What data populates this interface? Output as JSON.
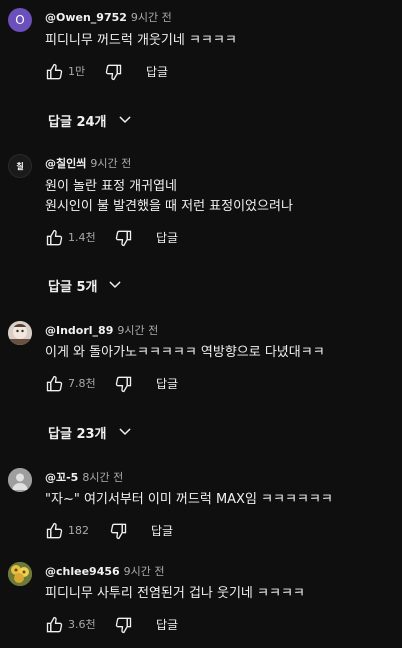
{
  "comments": [
    {
      "author": "@Owen_9752",
      "time": "9시간 전",
      "avatar_letter": "O",
      "avatar_color": "#6b4fbb",
      "lines": [
        "피디니무 꺼드럭 개웃기네 ㅋㅋㅋㅋ"
      ],
      "likes": "1만",
      "reply_label": "답글",
      "replies_label": "답글 24개"
    },
    {
      "author": "@칠인씌",
      "time": "9시간 전",
      "avatar_letter": "칠",
      "avatar_color": "#1a1a1a",
      "lines": [
        "원이 놀란 표정 개귀엽네",
        "원시인이 불 발견했을 때 저런 표정이었으려나"
      ],
      "likes": "1.4천",
      "reply_label": "답글",
      "replies_label": "답글 5개"
    },
    {
      "author": "@Indorl_89",
      "time": "9시간 전",
      "avatar_color": "#8a7565",
      "lines": [
        "이게 와 돌아가노ㅋㅋㅋㅋㅋ 역방향으로 다녔대ㅋㅋ"
      ],
      "likes": "7.8천",
      "reply_label": "답글",
      "replies_label": "답글 23개"
    },
    {
      "author": "@꼬-5",
      "time": "8시간 전",
      "avatar_color": "#9e9e9e",
      "lines": [
        "\"자~\" 여기서부터 이미 꺼드럭 MAX임 ㅋㅋㅋㅋㅋㅋ"
      ],
      "likes": "182",
      "reply_label": "답글"
    },
    {
      "author": "@chlee9456",
      "time": "9시간 전",
      "avatar_color": "#c9a23a",
      "lines": [
        "피디니무 사투리 전염된거 겁나 웃기네 ㅋㅋㅋㅋ"
      ],
      "likes": "3.6천",
      "reply_label": "답글"
    }
  ],
  "icons": {
    "like": "thumbs-up-icon",
    "dislike": "thumbs-down-icon",
    "expand": "chevron-down-icon"
  },
  "colors": {
    "background": "#0f0f0f",
    "text_primary": "#f1f1f1",
    "text_secondary": "#aaaaaa"
  }
}
